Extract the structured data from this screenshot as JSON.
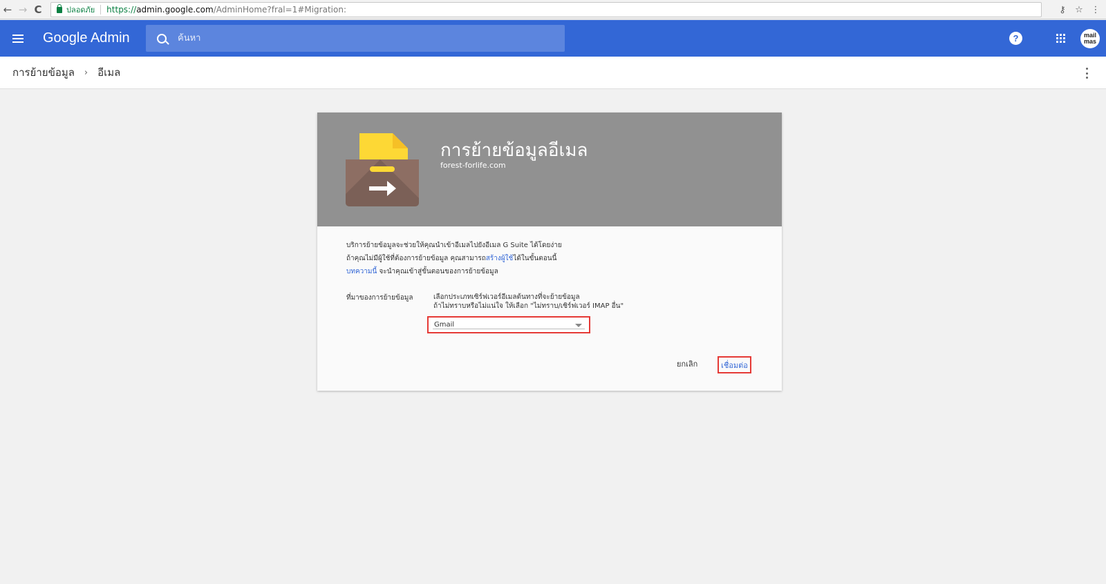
{
  "browser": {
    "back_icon": "←",
    "forward_icon": "→",
    "reload_icon": "C",
    "secure_label": "ปลอดภัย",
    "url_scheme": "https://",
    "url_host": "admin.google.com",
    "url_path": "/AdminHome?fral=1#Migration:",
    "key_icon": "⚷",
    "star_icon": "☆",
    "menu_icon": "⋮"
  },
  "header": {
    "brand": "Google Admin",
    "search_placeholder": "ค้นหา",
    "help_label": "?",
    "avatar_text": "mail mas",
    "color": "#3367d6"
  },
  "breadcrumb": {
    "items": [
      "การย้ายข้อมูล",
      "อีเมล"
    ],
    "separator": "›"
  },
  "card": {
    "title": "การย้ายข้อมูลอีเมล",
    "domain": "forest-forlife.com",
    "intro_line1": "บริการย้ายข้อมูลจะช่วยให้คุณนำเข้าอีเมลไปยังอีเมล G Suite ได้โดยง่าย",
    "intro_line2_pre": "ถ้าคุณไม่มีผู้ใช้ที่ต้องการย้ายข้อมูล คุณสามารถ",
    "intro_line2_link": "สร้างผู้ใช้",
    "intro_line2_post": "ได้ในขั้นตอนนี้",
    "intro_line3_link": "บทความนี้",
    "intro_line3_post": " จะนำคุณเข้าสู่ขั้นตอนของการย้ายข้อมูล",
    "source_label": "ที่มาของการย้ายข้อมูล",
    "source_help1": "เลือกประเภทเซิร์ฟเวอร์อีเมลต้นทางที่จะย้ายข้อมูล",
    "source_help2": "ถ้าไม่ทราบหรือไม่แน่ใจ ให้เลือก \"ไม่ทราบ/เซิร์ฟเวอร์ IMAP อื่น\"",
    "selected_source": "Gmail",
    "cancel_label": "ยกเลิก",
    "connect_label": "เชื่อมต่อ"
  }
}
